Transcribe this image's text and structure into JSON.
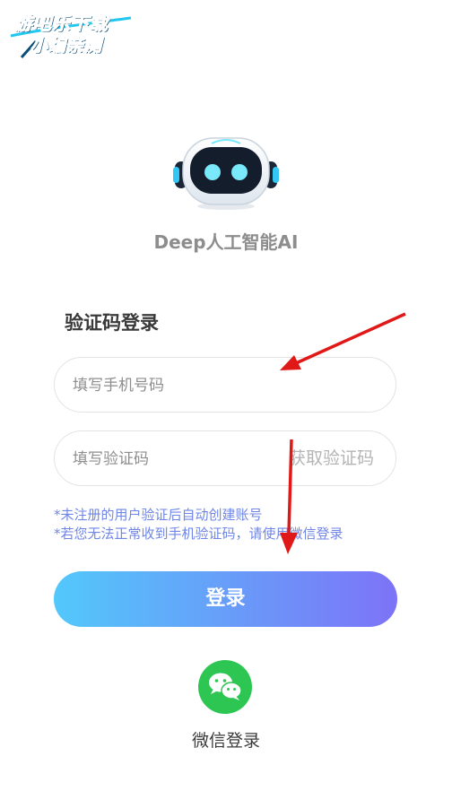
{
  "watermark": {
    "line1": "游吧乐下载",
    "line2": "小编亲测"
  },
  "app": {
    "name": "Deep人工智能AI",
    "logo_icon": "robot-icon"
  },
  "form": {
    "title": "验证码登录",
    "phone_placeholder": "填写手机号码",
    "code_placeholder": "填写验证码",
    "get_code_label": "获取验证码",
    "notes": [
      "*未注册的用户验证后自动创建账号",
      "*若您无法正常收到手机验证码，请使用微信登录"
    ],
    "login_label": "登录"
  },
  "wechat": {
    "label": "微信登录",
    "icon": "wechat-icon"
  },
  "colors": {
    "note_text": "#6f86e6",
    "button_gradient_start": "#52c8fb",
    "button_gradient_end": "#7d73f7",
    "wechat_green": "#2dc653",
    "annotation_arrow": "#e01818"
  }
}
